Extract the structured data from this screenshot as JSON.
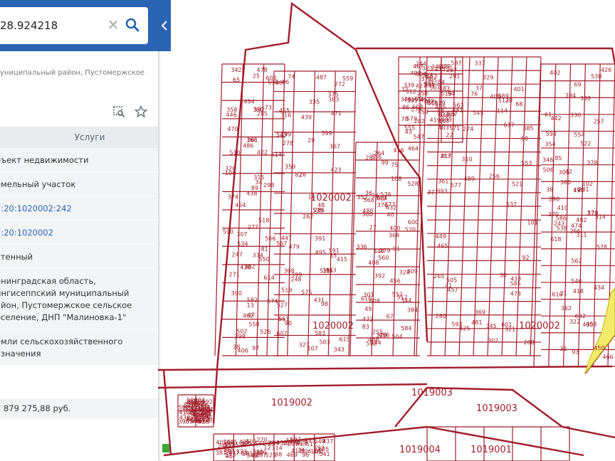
{
  "search": {
    "value": "28.924218"
  },
  "address_short": "униципальный район, Пустомержское",
  "services_tab": "Услуги",
  "info_rows": [
    {
      "label": "бъект недвижимости",
      "type": "text"
    },
    {
      "label": "емельный участок",
      "type": "text"
    },
    {
      "label": "7:20:1020002:242",
      "type": "link"
    },
    {
      "label": "7:20:1020002",
      "type": "link"
    },
    {
      "label": "чтенный",
      "type": "text"
    },
    {
      "label": "енинградская область,\nингисеппский муниципальный\nайон, Пустомержское сельское\nоселение, ДНП \"Малиновка-1\"",
      "type": "text"
    },
    {
      "label": "емли сельскохозяйственного\nазначения",
      "type": "text"
    }
  ],
  "price": "2 879 275,88 руб.",
  "map": {
    "block_labels": [
      "1020002",
      "1020002",
      "1020002",
      "1019002",
      "1019003",
      "1019003",
      "1019004",
      "1019001"
    ],
    "parcel_numbers": [
      "277",
      "278",
      "279",
      "280",
      "281",
      "282",
      "283",
      "284",
      "285",
      "286",
      "287",
      "288",
      "290",
      "291",
      "292",
      "293",
      "28",
      "29",
      "40",
      "41",
      "42",
      "43",
      "44",
      "33",
      "34",
      "35",
      "36",
      "37",
      "38",
      "39",
      "11",
      "12",
      "13",
      "14",
      "16",
      "20",
      "21",
      "22",
      "23",
      "24",
      "25",
      "26",
      "27",
      "30",
      "31",
      "32",
      "45",
      "46",
      "47",
      "48",
      "49",
      "60",
      "61",
      "62",
      "63",
      "64",
      "65",
      "66",
      "67",
      "68",
      "69",
      "70",
      "71",
      "72",
      "73",
      "74",
      "75",
      "76",
      "77",
      "78",
      "79",
      "80",
      "81",
      "82",
      "83",
      "84",
      "85",
      "86",
      "87",
      "88",
      "89",
      "90",
      "91",
      "92",
      "93",
      "94",
      "95",
      "96",
      "97",
      "98",
      "99",
      "101",
      "102",
      "103",
      "104",
      "105",
      "106",
      "107",
      "108",
      "114",
      "243",
      "244",
      "245",
      "246",
      "247",
      "248",
      "255",
      "256",
      "257",
      "258",
      "259",
      "260",
      "261",
      "262",
      "264",
      "265",
      "266",
      "267",
      "268",
      "270",
      "271",
      "272",
      "273",
      "274",
      "275",
      "276",
      "296",
      "297",
      "298",
      "299",
      "301",
      "302",
      "303",
      "304",
      "305",
      "306",
      "307",
      "308",
      "309",
      "310",
      "311",
      "312",
      "313",
      "314",
      "315",
      "316",
      "320",
      "321",
      "322",
      "323",
      "324",
      "325",
      "326",
      "327",
      "328",
      "329",
      "330",
      "331",
      "332",
      "333",
      "334",
      "335",
      "336",
      "337",
      "338",
      "339",
      "340",
      "341",
      "342",
      "343",
      "344",
      "345",
      "346",
      "347",
      "348",
      "349",
      "350",
      "351",
      "352",
      "353",
      "354",
      "355",
      "356",
      "357",
      "358",
      "359",
      "360",
      "361",
      "362",
      "363",
      "364",
      "365",
      "366",
      "367",
      "368",
      "369",
      "370",
      "371",
      "372",
      "373",
      "374",
      "375",
      "376",
      "377",
      "378",
      "379",
      "380",
      "381",
      "382",
      "383",
      "384",
      "385",
      "386",
      "387",
      "388",
      "389",
      "390",
      "391",
      "392",
      "393",
      "394",
      "395",
      "396",
      "397",
      "398",
      "399",
      "400",
      "401",
      "402",
      "403",
      "404",
      "405",
      "406",
      "407",
      "408",
      "409",
      "410",
      "411",
      "412",
      "413",
      "414",
      "415",
      "416",
      "417",
      "418",
      "419",
      "420",
      "421",
      "422",
      "423",
      "424",
      "425",
      "426",
      "427",
      "428",
      "429",
      "430",
      "431",
      "432",
      "433",
      "434",
      "435",
      "436",
      "437",
      "438",
      "439",
      "440",
      "441",
      "442",
      "443",
      "444",
      "445",
      "446",
      "447",
      "448",
      "449",
      "450",
      "451",
      "452",
      "453",
      "454",
      "455",
      "456",
      "457",
      "458",
      "459",
      "460",
      "461",
      "462",
      "463",
      "464",
      "465",
      "466",
      "467",
      "468",
      "469",
      "470",
      "471",
      "472",
      "473",
      "474",
      "475",
      "476",
      "477",
      "478",
      "479",
      "480",
      "481",
      "482",
      "483",
      "484",
      "485",
      "486",
      "487",
      "488",
      "489",
      "490",
      "491",
      "492",
      "493",
      "494",
      "495",
      "496",
      "497",
      "498",
      "499",
      "500",
      "501",
      "502",
      "503",
      "504",
      "505",
      "506",
      "507",
      "508",
      "509",
      "510",
      "511",
      "512",
      "513",
      "514",
      "515",
      "516",
      "517",
      "518",
      "519",
      "520",
      "521",
      "522",
      "523",
      "524",
      "525",
      "526",
      "527",
      "528",
      "529",
      "530",
      "531",
      "532",
      "533",
      "534",
      "535",
      "536",
      "537",
      "538",
      "539",
      "540",
      "541",
      "542",
      "543",
      "544",
      "545",
      "546",
      "547",
      "548",
      "549",
      "550",
      "551",
      "552",
      "553",
      "554",
      "555",
      "556",
      "557",
      "558",
      "559",
      "560",
      "561",
      "562",
      "563",
      "564",
      "565",
      "566",
      "567",
      "568",
      "569",
      "570",
      "571",
      "572",
      "573",
      "574",
      "575",
      "576",
      "577",
      "578",
      "579",
      "580",
      "581",
      "582",
      "583",
      "584",
      "585",
      "586",
      "587",
      "588",
      "589",
      "590",
      "591",
      "592",
      "593",
      "594",
      "595",
      "596",
      "597",
      "598",
      "599",
      "600",
      "601",
      "602",
      "603",
      "604",
      "605",
      "606",
      "607",
      "608",
      "609",
      "610",
      "611",
      "612",
      "613",
      "614",
      "615",
      "616",
      "617",
      "618",
      "619",
      "620"
    ],
    "line_color": "#a11d2a",
    "highlight_color": "#f2ea6b"
  }
}
